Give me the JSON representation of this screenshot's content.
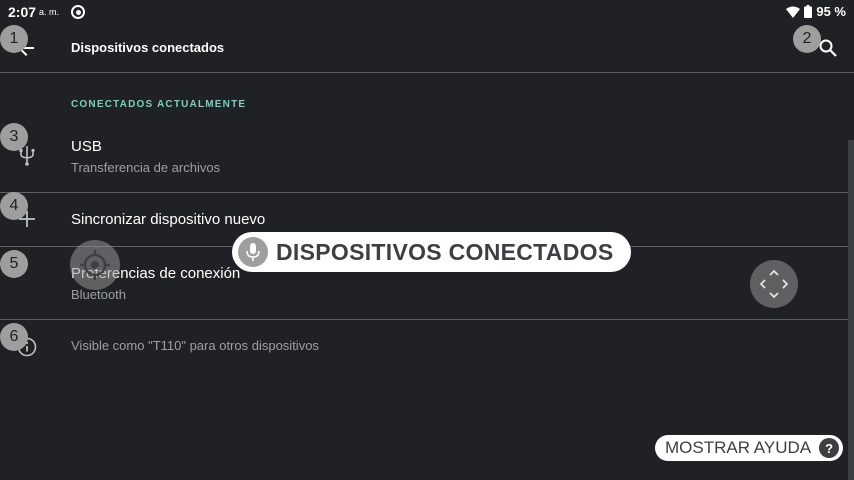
{
  "status": {
    "time": "2:07",
    "ampm": "a. m.",
    "battery": "95 %"
  },
  "toolbar": {
    "title": "Dispositivos conectados"
  },
  "section": {
    "header": "CONECTADOS ACTUALMENTE"
  },
  "rows": [
    {
      "title": "USB",
      "subtitle": "Transferencia de archivos",
      "icon": "usb-icon"
    },
    {
      "title": "Sincronizar dispositivo nuevo",
      "icon": "plus-icon"
    },
    {
      "title": "Preferencias de conexión",
      "subtitle": "Bluetooth",
      "icon": "none"
    },
    {
      "title": "Visible como \"T110\" para otros dispositivos",
      "icon": "info-icon"
    }
  ],
  "badges": [
    "1",
    "2",
    "3",
    "4",
    "5",
    "6"
  ],
  "overlay": {
    "voice_label": "DISPOSITIVOS CONECTADOS",
    "help_label": "MOSTRAR AYUDA",
    "help_q": "?"
  },
  "colors": {
    "background": "#202124",
    "accent": "#80cbc4",
    "divider": "#5f6368"
  }
}
